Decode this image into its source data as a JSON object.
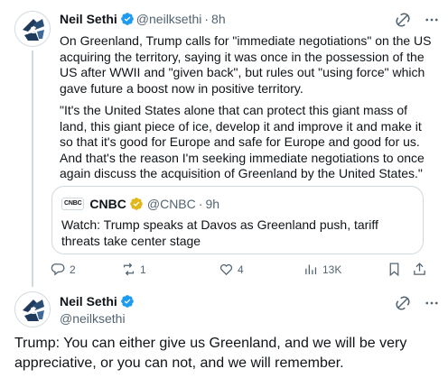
{
  "tweet1": {
    "author_name": "Neil Sethi",
    "author_handle": "@neilksethi",
    "separator": "·",
    "time": "8h",
    "paragraph1": "On Greenland, Trump calls for \"immediate negotiations\" on the US acquiring the territory, saying it was once in the possession of the US after WWII and \"given back\", but rules out \"using force\" which gave future a boost now in positive territory.",
    "paragraph2": "\"It's the United States alone that can protect this giant mass of land, this giant piece of ice, develop it and improve it and make it so that it's good for Europe and safe for Europe and good for us. And that's the reason I'm seeking immediate negotiations to once again discuss the acquisition of Greenland by the United States.\"",
    "quote": {
      "logo_text": "CNBC",
      "name": "CNBC",
      "handle": "@CNBC",
      "separator": "·",
      "time": "9h",
      "text": "Watch: Trump speaks at Davos as Greenland push, tariff threats take center stage"
    },
    "actions": {
      "replies": "2",
      "reposts": "1",
      "likes": "4",
      "views": "13K"
    }
  },
  "tweet2": {
    "author_name": "Neil Sethi",
    "author_handle": "@neilksethi",
    "text": "Trump: You can either give us Greenland, and we will be very appreciative, or you can not, and we will remember."
  },
  "colors": {
    "text": "#0f1419",
    "secondary": "#536471",
    "verified_blue": "#1d9bf0",
    "verified_gold": "#e2b719",
    "border": "#cfd9de"
  },
  "icons": [
    "avatar-logo",
    "verified-badge-icon",
    "grok-icon",
    "more-icon",
    "reply-icon",
    "repost-icon",
    "like-icon",
    "views-icon",
    "bookmark-icon",
    "share-icon",
    "gold-verified-badge-icon"
  ]
}
